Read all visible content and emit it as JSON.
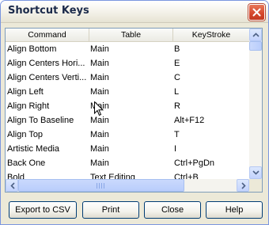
{
  "window": {
    "title": "Shortcut Keys"
  },
  "table": {
    "columns": [
      "Command",
      "Table",
      "KeyStroke"
    ],
    "rows": [
      [
        "Align Bottom",
        "Main",
        "B"
      ],
      [
        "Align Centers Hori...",
        "Main",
        "E"
      ],
      [
        "Align Centers Verti...",
        "Main",
        "C"
      ],
      [
        "Align Left",
        "Main",
        "L"
      ],
      [
        "Align Right",
        "Main",
        "R"
      ],
      [
        "Align To Baseline",
        "Main",
        "Alt+F12"
      ],
      [
        "Align Top",
        "Main",
        "T"
      ],
      [
        "Artistic Media",
        "Main",
        "I"
      ],
      [
        "Back One",
        "Main",
        "Ctrl+PgDn"
      ],
      [
        "Bold",
        "Text Editing",
        "Ctrl+B"
      ]
    ]
  },
  "buttons": {
    "export": "Export to CSV",
    "print": "Print",
    "close": "Close",
    "help": "Help"
  }
}
